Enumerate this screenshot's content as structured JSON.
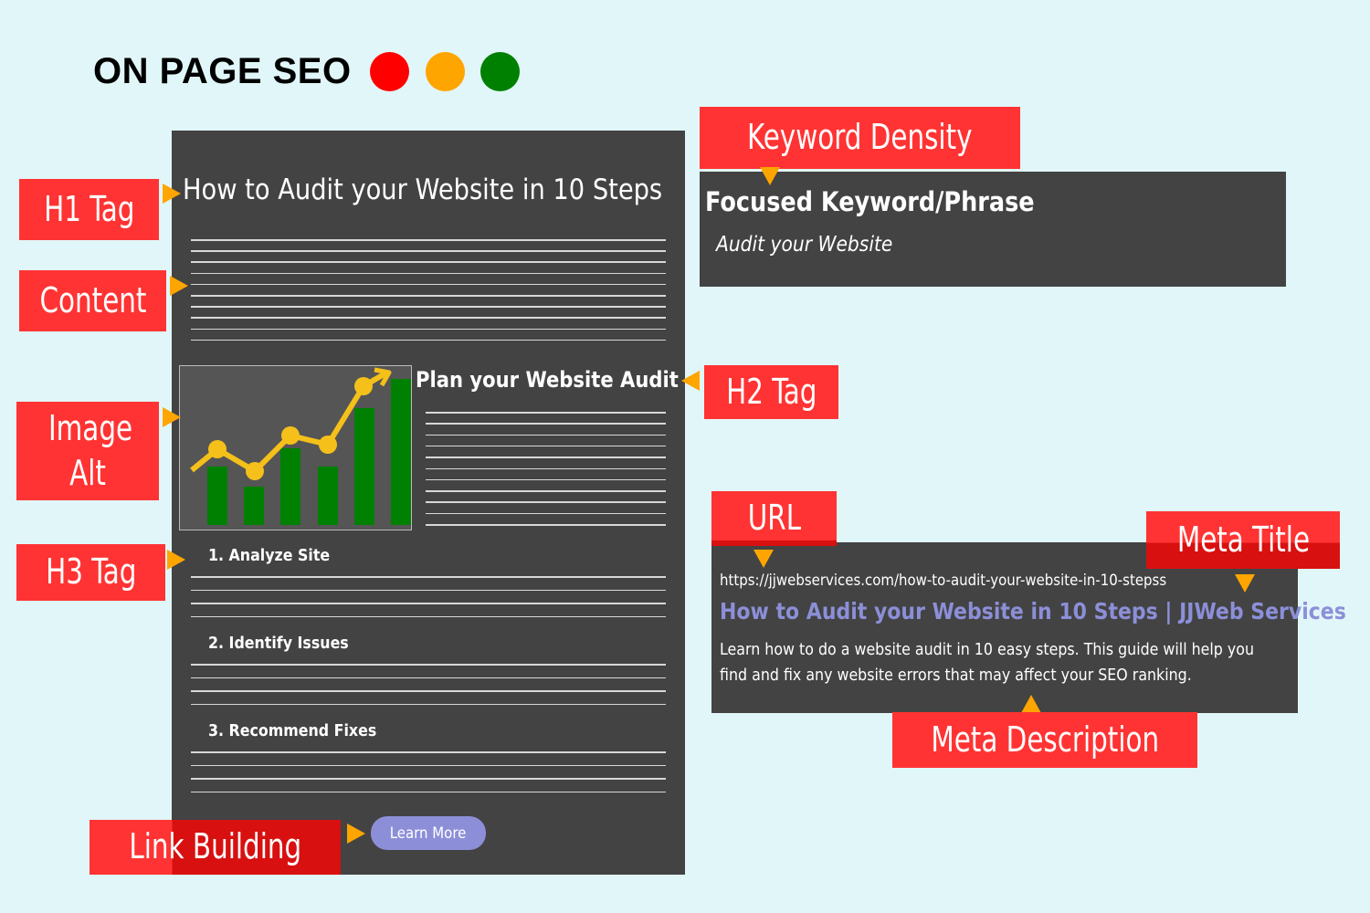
{
  "header": {
    "title": "ON PAGE SEO",
    "dots": [
      "#FF0000",
      "#FFA500",
      "#008000"
    ]
  },
  "labels": {
    "h1": "H1 Tag",
    "content": "Content",
    "image_alt": "Image Alt",
    "h3": "H3 Tag",
    "link_building": "Link Building",
    "keyword_density": "Keyword Density",
    "h2": "H2 Tag",
    "url": "URL",
    "meta_title": "Meta Title",
    "meta_description": "Meta Description"
  },
  "page": {
    "h1": "How to Audit your Website in 10 Steps",
    "h2": "Plan your Website Audit",
    "h3_items": [
      "1. Analyze Site",
      "2. Identify Issues",
      "3. Recommend Fixes"
    ],
    "button": "Learn More"
  },
  "keyword": {
    "heading": "Focused Keyword/Phrase",
    "value": "Audit your Website"
  },
  "serp": {
    "url": "https://jjwebservices.com/how-to-audit-your-website-in-10-stepss",
    "title": "How to Audit your Website in 10 Steps | JJWeb Services",
    "description": "Learn how to do a website audit in 10 easy steps. This guide will help you find and fix any website errors that may affect your SEO ranking."
  },
  "colors": {
    "label_bg": "#FF3333",
    "panel_bg": "#434343",
    "arrow": "#FFA500",
    "link": "#8C8FD8",
    "bars": "#008000",
    "trend": "#F5C01A"
  }
}
